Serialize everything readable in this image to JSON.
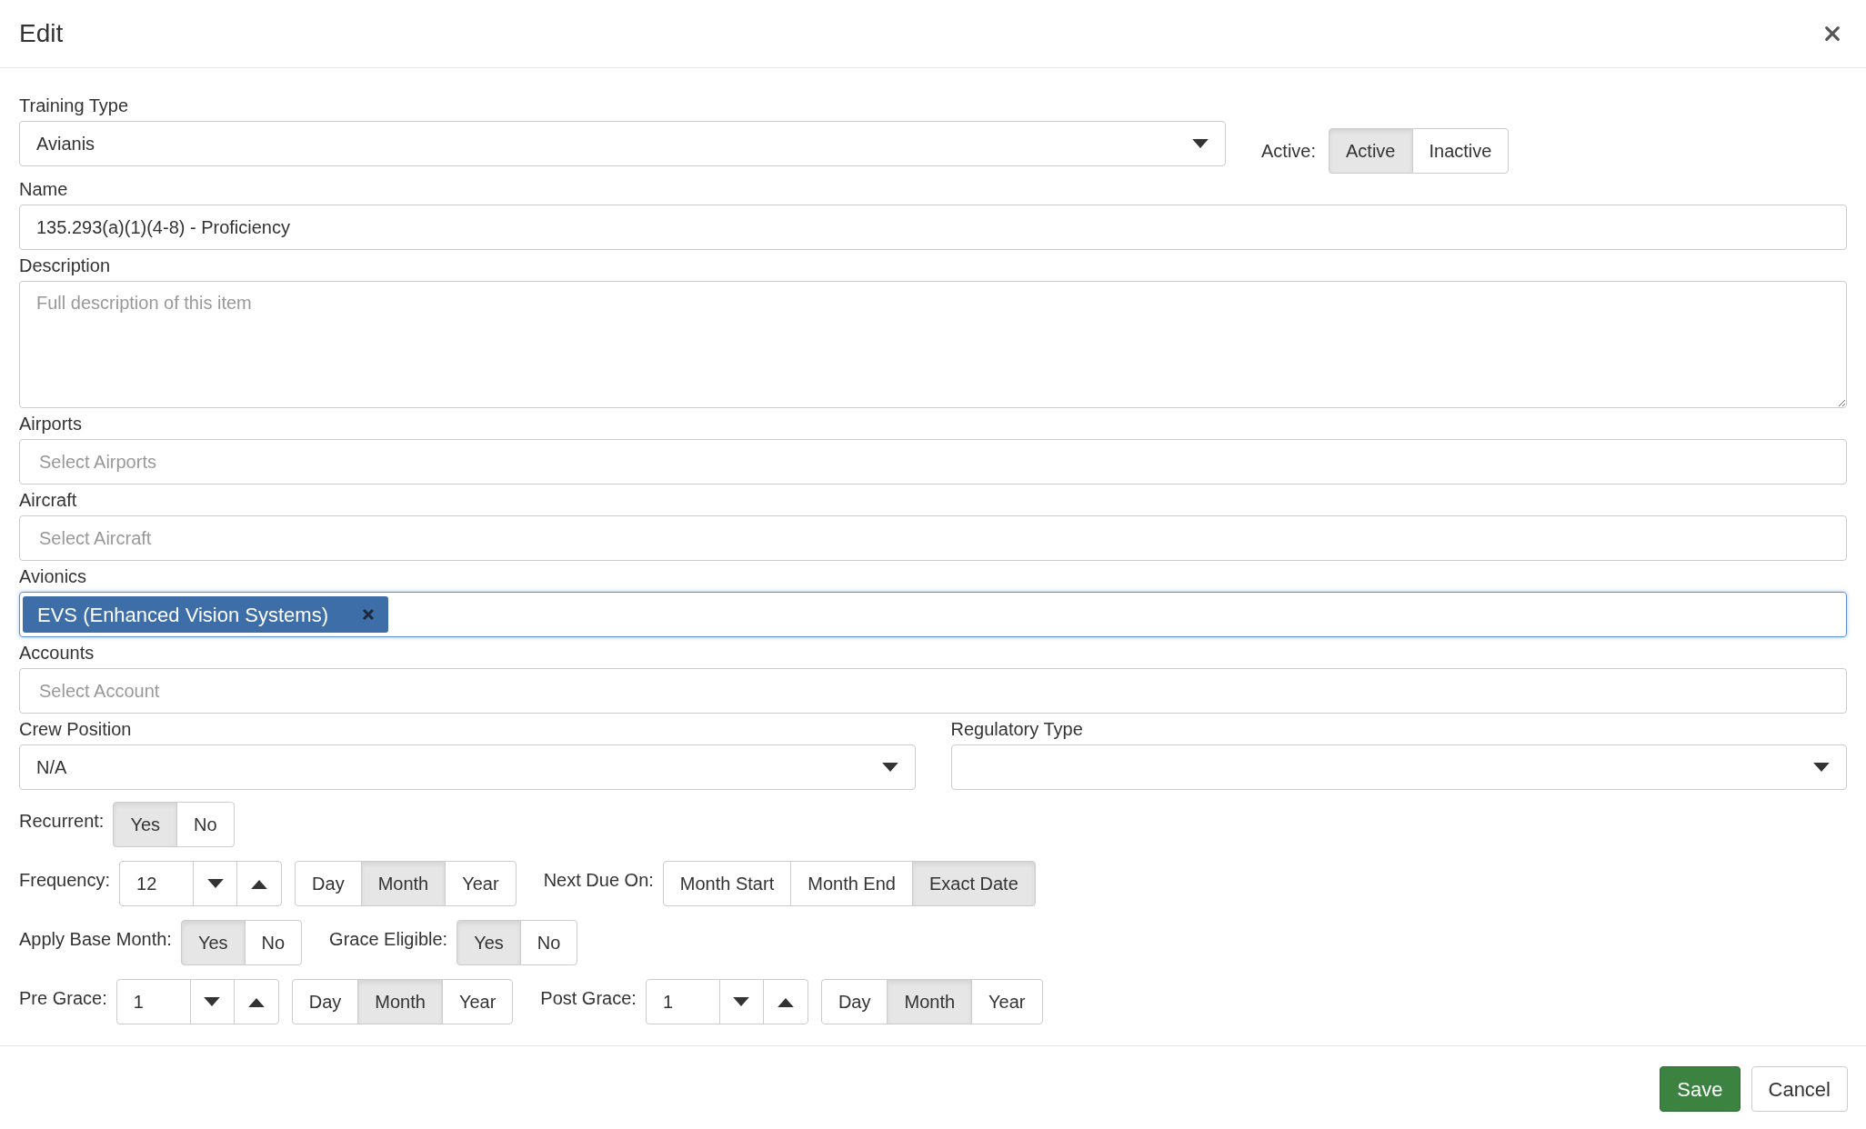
{
  "dialog": {
    "title": "Edit"
  },
  "training_type": {
    "label": "Training Type",
    "value": "Avianis"
  },
  "active": {
    "label": "Active:",
    "options": [
      {
        "label": "Active",
        "selected": true
      },
      {
        "label": "Inactive",
        "selected": false
      }
    ]
  },
  "fields": [
    {
      "kind": "text",
      "label": "Name",
      "value": "135.293(a)(1)(4-8) - Proficiency"
    },
    {
      "kind": "textarea",
      "label": "Description",
      "placeholder": "Full description of this item"
    },
    {
      "kind": "multiselect",
      "label": "Airports",
      "placeholder": "Select Airports",
      "focused": false
    },
    {
      "kind": "multiselect",
      "label": "Aircraft",
      "placeholder": "Select Aircraft",
      "focused": false
    },
    {
      "kind": "multiselect",
      "label": "Avionics",
      "focused": true,
      "tags": [
        "EVS (Enhanced Vision Systems)"
      ]
    },
    {
      "kind": "multiselect",
      "label": "Accounts",
      "placeholder": "Select Account",
      "focused": false
    }
  ],
  "selects": [
    {
      "label": "Crew Position",
      "value": "N/A"
    },
    {
      "label": "Regulatory Type"
    }
  ],
  "option_rows": [
    [
      {
        "kind": "toggle",
        "label": "Recurrent:",
        "options": [
          {
            "label": "Yes",
            "selected": true
          },
          {
            "label": "No",
            "selected": false
          }
        ]
      }
    ],
    [
      {
        "kind": "spinner",
        "label": "Frequency:",
        "value": "12"
      },
      {
        "kind": "units",
        "options": [
          {
            "label": "Day",
            "selected": false
          },
          {
            "label": "Month",
            "selected": true
          },
          {
            "label": "Year",
            "selected": false
          }
        ]
      },
      {
        "kind": "toggle",
        "label": "Next Due On:",
        "options": [
          {
            "label": "Month Start",
            "selected": false
          },
          {
            "label": "Month End",
            "selected": false
          },
          {
            "label": "Exact Date",
            "selected": true
          }
        ]
      }
    ],
    [
      {
        "kind": "toggle",
        "label": "Apply Base Month:",
        "options": [
          {
            "label": "Yes",
            "selected": true
          },
          {
            "label": "No",
            "selected": false
          }
        ]
      },
      {
        "kind": "toggle",
        "label": "Grace Eligible:",
        "options": [
          {
            "label": "Yes",
            "selected": true
          },
          {
            "label": "No",
            "selected": false
          }
        ]
      }
    ],
    [
      {
        "kind": "spinner",
        "label": "Pre Grace:",
        "value": "1"
      },
      {
        "kind": "units",
        "options": [
          {
            "label": "Day",
            "selected": false
          },
          {
            "label": "Month",
            "selected": true
          },
          {
            "label": "Year",
            "selected": false
          }
        ]
      },
      {
        "kind": "spinner",
        "label": "Post Grace:",
        "value": "1"
      },
      {
        "kind": "units",
        "options": [
          {
            "label": "Day",
            "selected": false
          },
          {
            "label": "Month",
            "selected": true
          },
          {
            "label": "Year",
            "selected": false
          }
        ]
      }
    ]
  ],
  "buttons": [
    {
      "kind": "primary",
      "label": "Save"
    },
    {
      "kind": "secondary",
      "label": "Cancel"
    }
  ]
}
